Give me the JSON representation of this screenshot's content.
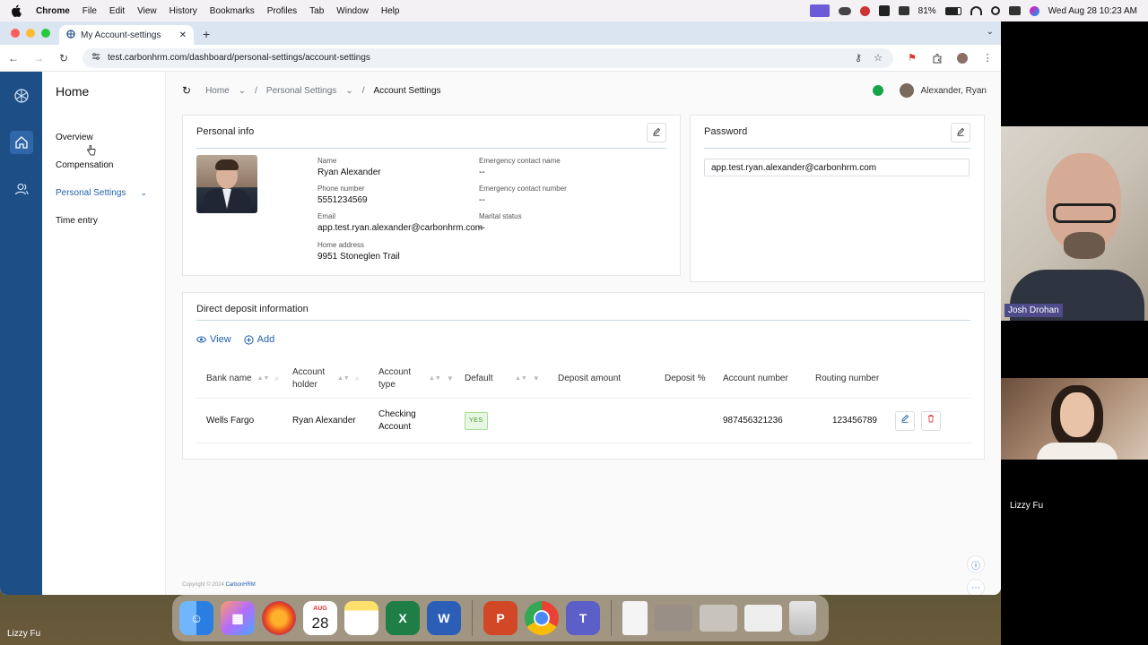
{
  "menubar": {
    "app": "Chrome",
    "items": [
      "File",
      "Edit",
      "View",
      "History",
      "Bookmarks",
      "Profiles",
      "Tab",
      "Window",
      "Help"
    ],
    "battery": "81%",
    "datetime": "Wed Aug 28  10:23 AM"
  },
  "browser": {
    "tab_title": "My Account-settings",
    "url": "test.carbonhrm.com/dashboard/personal-settings/account-settings"
  },
  "sidebar": {
    "title": "Home",
    "items": [
      {
        "label": "Overview"
      },
      {
        "label": "Compensation"
      },
      {
        "label": "Personal Settings"
      },
      {
        "label": "Time entry"
      }
    ]
  },
  "breadcrumb": {
    "home": "Home",
    "section": "Personal Settings",
    "current": "Account Settings"
  },
  "user": {
    "name": "Alexander, Ryan"
  },
  "personal_info": {
    "title": "Personal info",
    "name_label": "Name",
    "name": "Ryan Alexander",
    "phone_label": "Phone number",
    "phone": "5551234569",
    "email_label": "Email",
    "email": "app.test.ryan.alexander@carbonhrm.com",
    "address_label": "Home address",
    "address": "9951 Stoneglen Trail",
    "ec_name_label": "Emergency contact name",
    "ec_name": "--",
    "ec_number_label": "Emergency contact number",
    "ec_number": "--",
    "marital_label": "Marital status",
    "marital": "--"
  },
  "password": {
    "title": "Password",
    "value": "app.test.ryan.alexander@carbonhrm.com"
  },
  "direct_deposit": {
    "title": "Direct deposit information",
    "view_label": "View",
    "add_label": "Add",
    "columns": [
      "Bank name",
      "Account holder",
      "Account type",
      "Default",
      "Deposit amount",
      "Deposit %",
      "Account number",
      "Routing number"
    ],
    "rows": [
      {
        "bank": "Wells Fargo",
        "holder": "Ryan Alexander",
        "type": "Checking Account",
        "default": "YES",
        "amount": "",
        "percent": "",
        "account_number": "987456321236",
        "routing_number": "123456789"
      }
    ]
  },
  "footer": {
    "copyright": "Copyright © 2024 ",
    "brand": "CarbonHRM"
  },
  "video": {
    "participant1": "Josh Drohan",
    "participant2": "Lizzy Fu",
    "self_name": "Lizzy Fu"
  },
  "dock": {
    "calendar_month": "AUG",
    "calendar_day": "28"
  },
  "colors": {
    "rail": "#1d4f86",
    "accent": "#1f5fa8",
    "badge_green": "#3c9a2a"
  }
}
